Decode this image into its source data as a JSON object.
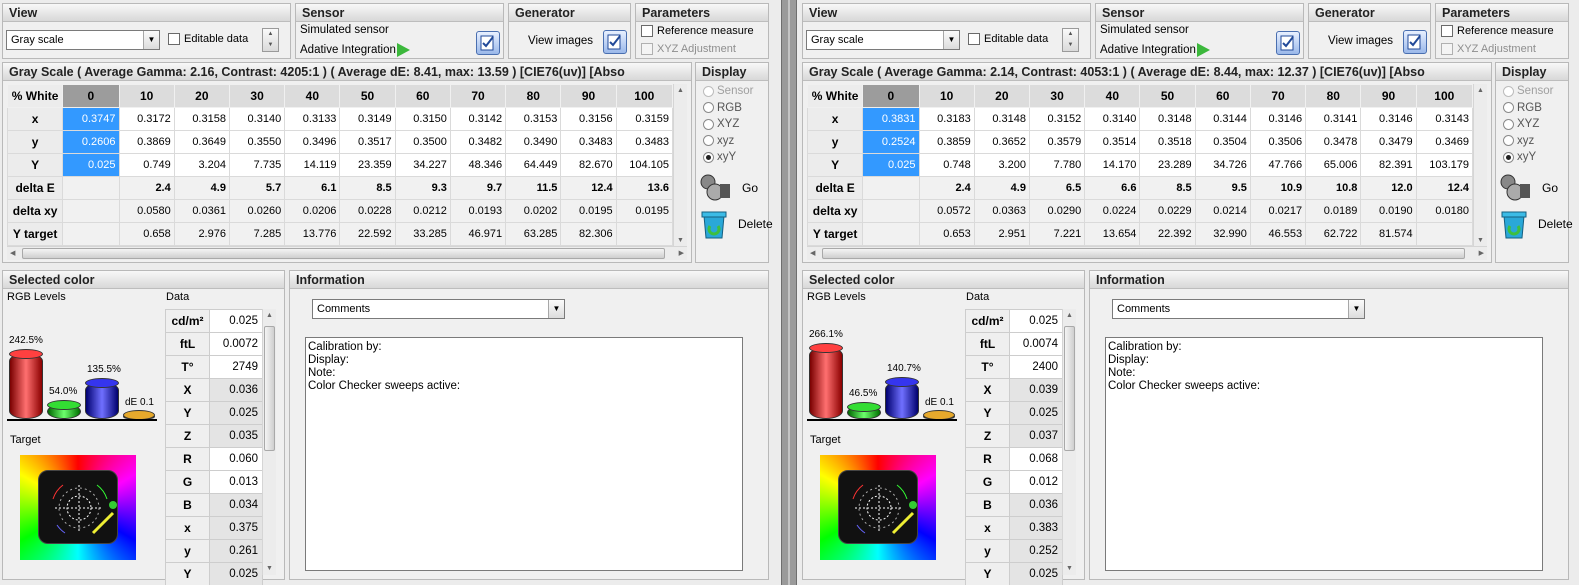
{
  "panes": [
    {
      "view": {
        "title": "View",
        "combo_value": "Gray scale",
        "editable_label": "Editable data"
      },
      "sensor": {
        "title": "Sensor",
        "line1": "Simulated sensor",
        "line2": "Adative Integration"
      },
      "generator": {
        "title": "Generator",
        "button_label": "View images"
      },
      "parameters": {
        "title": "Parameters",
        "reference_label": "Reference measure",
        "xyz_adjust_label": "XYZ Adjustment"
      },
      "grayscale": {
        "title": "Gray Scale ( Average Gamma: 2.16, Contrast: 4205:1 ) ( Average dE: 8.41, max: 13.59 ) [CIE76(uv)] [Abso",
        "columns": [
          "% White",
          "0",
          "10",
          "20",
          "30",
          "40",
          "50",
          "60",
          "70",
          "80",
          "90",
          "100"
        ],
        "rows": [
          {
            "label": "x",
            "values": [
              "0.3747",
              "0.3172",
              "0.3158",
              "0.3140",
              "0.3133",
              "0.3149",
              "0.3150",
              "0.3142",
              "0.3153",
              "0.3156",
              "0.3159"
            ]
          },
          {
            "label": "y",
            "values": [
              "0.2606",
              "0.3869",
              "0.3649",
              "0.3550",
              "0.3496",
              "0.3517",
              "0.3500",
              "0.3482",
              "0.3490",
              "0.3483",
              "0.3483"
            ]
          },
          {
            "label": "Y",
            "values": [
              "0.025",
              "0.749",
              "3.204",
              "7.735",
              "14.119",
              "23.359",
              "34.227",
              "48.346",
              "64.449",
              "82.670",
              "104.105"
            ]
          },
          {
            "label": "delta E",
            "values": [
              "",
              "2.4",
              "4.9",
              "5.7",
              "6.1",
              "8.5",
              "9.3",
              "9.7",
              "11.5",
              "12.4",
              "13.6"
            ]
          },
          {
            "label": "delta xy",
            "values": [
              "",
              "0.0580",
              "0.0361",
              "0.0260",
              "0.0206",
              "0.0228",
              "0.0212",
              "0.0193",
              "0.0202",
              "0.0195",
              "0.0195"
            ]
          },
          {
            "label": "Y target",
            "values": [
              "",
              "0.658",
              "2.976",
              "7.285",
              "13.776",
              "22.592",
              "33.285",
              "46.971",
              "63.285",
              "82.306",
              ""
            ]
          }
        ]
      },
      "display": {
        "title": "Display",
        "options": [
          "Sensor",
          "RGB",
          "XYZ",
          "xyz",
          "xyY"
        ],
        "selected": "xyY",
        "go_label": "Go",
        "delete_label": "Delete"
      },
      "selected_color": {
        "title": "Selected color",
        "rgb_levels_label": "RGB Levels",
        "data_label": "Data",
        "target_label": "Target",
        "red_pct": "242.5%",
        "green_pct": "54.0%",
        "blue_pct": "135.5%",
        "de_label": "dE 0.1",
        "red_level": 242.5,
        "green_level": 54.0,
        "blue_level": 135.5,
        "data_keys": [
          "cd/m²",
          "ftL",
          "T°",
          "X",
          "Y",
          "Z",
          "R",
          "G",
          "B",
          "x",
          "y",
          "Y"
        ],
        "data_values": [
          "0.025",
          "0.0072",
          "2749",
          "0.036",
          "0.025",
          "0.035",
          "0.060",
          "0.013",
          "0.034",
          "0.375",
          "0.261",
          "0.025"
        ]
      },
      "information": {
        "title": "Information",
        "combo_value": "Comments",
        "memo": "Calibration by:\nDisplay:\nNote:\nColor Checker sweeps active:"
      }
    },
    {
      "view": {
        "title": "View",
        "combo_value": "Gray scale",
        "editable_label": "Editable data"
      },
      "sensor": {
        "title": "Sensor",
        "line1": "Simulated sensor",
        "line2": "Adative Integration"
      },
      "generator": {
        "title": "Generator",
        "button_label": "View images"
      },
      "parameters": {
        "title": "Parameters",
        "reference_label": "Reference measure",
        "xyz_adjust_label": "XYZ Adjustment"
      },
      "grayscale": {
        "title": "Gray Scale ( Average Gamma: 2.14, Contrast: 4053:1 ) ( Average dE: 8.44, max: 12.37 ) [CIE76(uv)] [Abso",
        "columns": [
          "% White",
          "0",
          "10",
          "20",
          "30",
          "40",
          "50",
          "60",
          "70",
          "80",
          "90",
          "100"
        ],
        "rows": [
          {
            "label": "x",
            "values": [
              "0.3831",
              "0.3183",
              "0.3148",
              "0.3152",
              "0.3140",
              "0.3148",
              "0.3144",
              "0.3146",
              "0.3141",
              "0.3146",
              "0.3143"
            ]
          },
          {
            "label": "y",
            "values": [
              "0.2524",
              "0.3859",
              "0.3652",
              "0.3579",
              "0.3514",
              "0.3518",
              "0.3504",
              "0.3506",
              "0.3478",
              "0.3479",
              "0.3469"
            ]
          },
          {
            "label": "Y",
            "values": [
              "0.025",
              "0.748",
              "3.200",
              "7.780",
              "14.170",
              "23.289",
              "34.726",
              "47.766",
              "65.006",
              "82.391",
              "103.179"
            ]
          },
          {
            "label": "delta E",
            "values": [
              "",
              "2.4",
              "4.9",
              "6.5",
              "6.6",
              "8.5",
              "9.5",
              "10.9",
              "10.8",
              "12.0",
              "12.4"
            ]
          },
          {
            "label": "delta xy",
            "values": [
              "",
              "0.0572",
              "0.0363",
              "0.0290",
              "0.0224",
              "0.0229",
              "0.0214",
              "0.0217",
              "0.0189",
              "0.0190",
              "0.0180"
            ]
          },
          {
            "label": "Y target",
            "values": [
              "",
              "0.653",
              "2.951",
              "7.221",
              "13.654",
              "22.392",
              "32.990",
              "46.553",
              "62.722",
              "81.574",
              ""
            ]
          }
        ]
      },
      "display": {
        "title": "Display",
        "options": [
          "Sensor",
          "RGB",
          "XYZ",
          "xyz",
          "xyY"
        ],
        "selected": "xyY",
        "go_label": "Go",
        "delete_label": "Delete"
      },
      "selected_color": {
        "title": "Selected color",
        "rgb_levels_label": "RGB Levels",
        "data_label": "Data",
        "target_label": "Target",
        "red_pct": "266.1%",
        "green_pct": "46.5%",
        "blue_pct": "140.7%",
        "de_label": "dE 0.1",
        "red_level": 266.1,
        "green_level": 46.5,
        "blue_level": 140.7,
        "data_keys": [
          "cd/m²",
          "ftL",
          "T°",
          "X",
          "Y",
          "Z",
          "R",
          "G",
          "B",
          "x",
          "y",
          "Y"
        ],
        "data_values": [
          "0.025",
          "0.0074",
          "2400",
          "0.039",
          "0.025",
          "0.037",
          "0.068",
          "0.012",
          "0.036",
          "0.383",
          "0.252",
          "0.025"
        ]
      },
      "information": {
        "title": "Information",
        "combo_value": "Comments",
        "memo": "Calibration by:\nDisplay:\nNote:\nColor Checker sweeps active:"
      }
    }
  ]
}
